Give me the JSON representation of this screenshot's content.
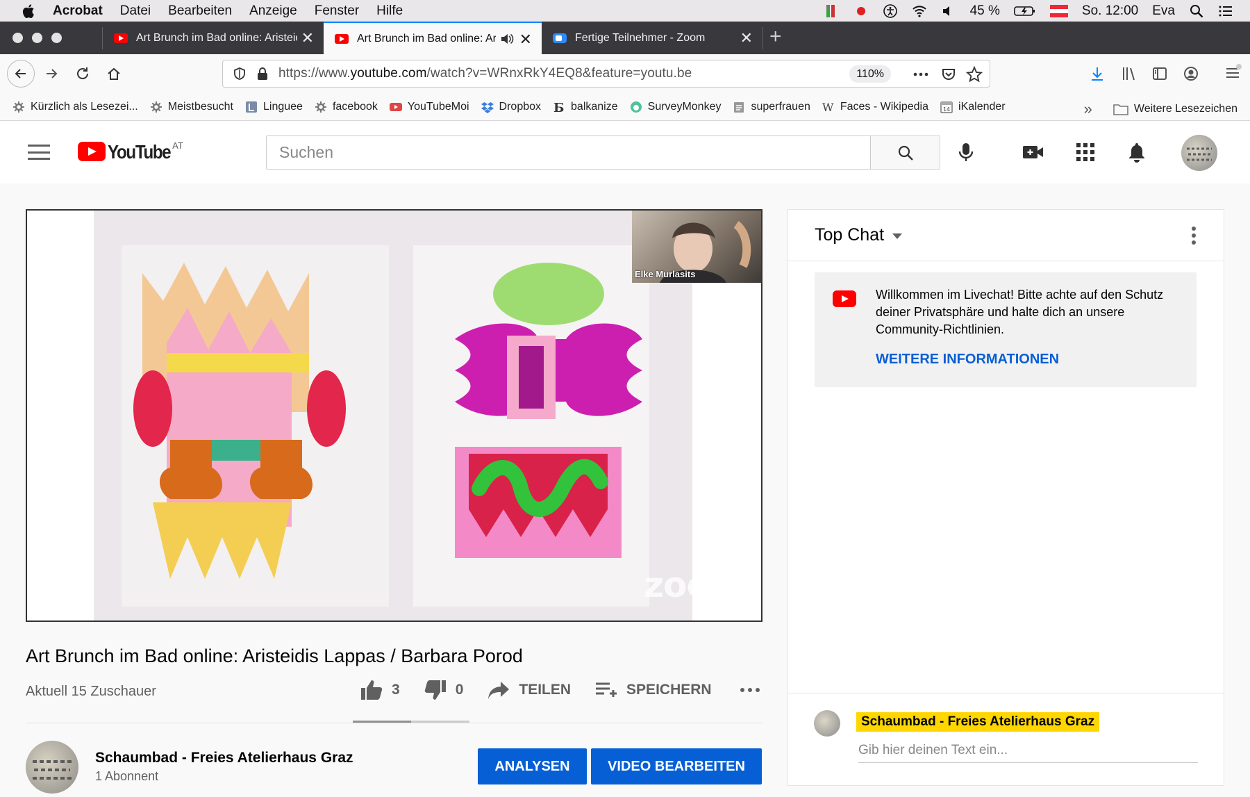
{
  "menubar": {
    "app": "Acrobat",
    "items": [
      "Datei",
      "Bearbeiten",
      "Anzeige",
      "Fenster",
      "Hilfe"
    ],
    "battery": "45 %",
    "clock": "So. 12:00",
    "user": "Eva"
  },
  "tabs": [
    {
      "title": "Art Brunch im Bad online: Aristeidis Lappas / Barbara Porod",
      "favicon": "youtube-icon"
    },
    {
      "title": "Art Brunch im Bad online: Aristeidis Lappas / Barbara Porod",
      "favicon": "youtube-icon"
    },
    {
      "title": "Fertige Teilnehmer - Zoom",
      "favicon": "zoom-icon"
    }
  ],
  "navbar": {
    "url_prefix": "https://www.",
    "url_domain": "youtube.com",
    "url_rest": "/watch?v=WRnxRkY4EQ8&feature=youtu.be",
    "zoom": "110%"
  },
  "bookmarks": [
    {
      "label": "Kürzlich als Lesezei...",
      "icon": "gear-icon"
    },
    {
      "label": "Meistbesucht",
      "icon": "gear-icon"
    },
    {
      "label": "Linguee",
      "icon": "linguee-icon"
    },
    {
      "label": "facebook",
      "icon": "gear-icon"
    },
    {
      "label": "YouTubeMoi",
      "icon": "youtube-icon"
    },
    {
      "label": "Dropbox",
      "icon": "dropbox-icon"
    },
    {
      "label": "balkanize",
      "icon": "b-icon"
    },
    {
      "label": "SurveyMonkey",
      "icon": "surveymonkey-icon"
    },
    {
      "label": "superfrauen",
      "icon": "clipboard-icon"
    },
    {
      "label": "Faces - Wikipedia",
      "icon": "wikipedia-icon"
    },
    {
      "label": "iKalender",
      "icon": "calendar-icon"
    }
  ],
  "bookmarks_more": "Weitere Lesezeichen",
  "calendar_day": "14",
  "youtube": {
    "logo_text": "YouTube",
    "country": "AT",
    "search_placeholder": "Suchen"
  },
  "video": {
    "presenter_name": "Elke Murlasits",
    "watermark": "zoom",
    "title": "Art Brunch im Bad online: Aristeidis Lappas / Barbara Porod",
    "viewers": "Aktuell 15 Zuschauer",
    "likes": "3",
    "dislikes": "0",
    "like_ratio": 1.0,
    "share_label": "TEILEN",
    "save_label": "SPEICHERN"
  },
  "channel": {
    "name": "Schaumbad - Freies Atelierhaus Graz",
    "subscribers": "1 Abonnent",
    "analytics_label": "ANALYSEN",
    "edit_label": "VIDEO BEARBEITEN"
  },
  "chat": {
    "header": "Top Chat",
    "welcome_text": "Willkommen im Livechat! Bitte achte auf den Schutz deiner Privatsphäre und halte dich an unsere Community-Richtlinien.",
    "welcome_link": "WEITERE INFORMATIONEN",
    "author": "Schaumbad - Freies Atelierhaus Graz",
    "input_placeholder": "Gib hier deinen Text ein..."
  },
  "colors": {
    "youtube_red": "#ff0000",
    "link_blue": "#065fd4",
    "author_highlight": "#ffd600",
    "firefox_tab_dark": "#38383d",
    "firefox_accent": "#0a84ff"
  }
}
